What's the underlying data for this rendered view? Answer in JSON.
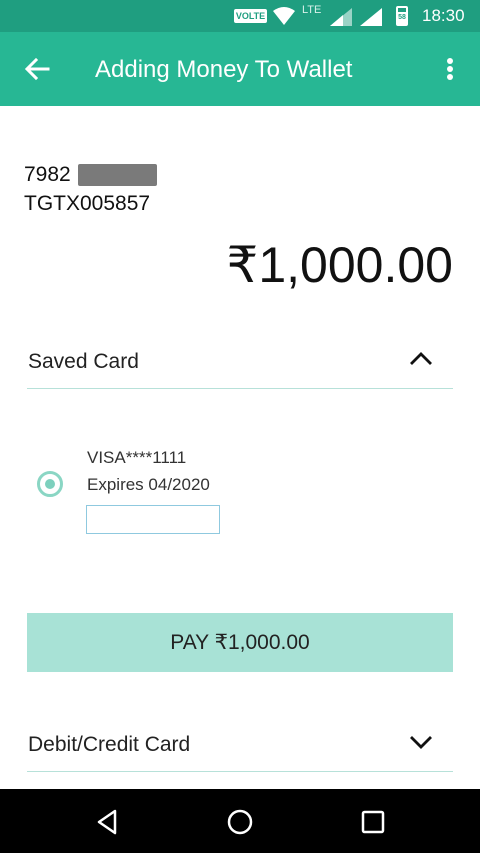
{
  "status_bar": {
    "volte": "VOLTE",
    "network": "LTE",
    "time": "18:30"
  },
  "app_bar": {
    "title": "Adding Money To Wallet",
    "back_icon": "arrow-left-icon",
    "more_icon": "more-vert-icon"
  },
  "transaction": {
    "phone_prefix": "7982",
    "transaction_id": "TGTX005857",
    "amount": "₹1,000.00"
  },
  "saved_card_section": {
    "label": "Saved Card",
    "expanded": true,
    "card": {
      "name": "VISA****1111",
      "expiry": "Expires 04/2020",
      "selected": true,
      "cvv_value": ""
    }
  },
  "pay_button": {
    "label": "PAY ₹1,000.00"
  },
  "debit_credit_section": {
    "label": "Debit/Credit Card",
    "expanded": false
  },
  "colors": {
    "status_bar": "#1f9e80",
    "app_bar": "#27b794",
    "pay_button": "#a8e2d6",
    "divider": "#b7e1d9"
  }
}
